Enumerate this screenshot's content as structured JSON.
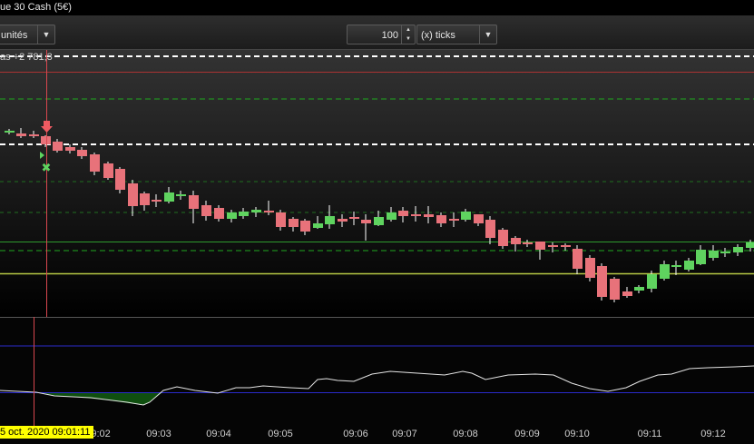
{
  "window": {
    "title": "ue 30 Cash (5€)"
  },
  "toolbar": {
    "units_label": "unités",
    "quantity_value": "100",
    "ticks_label": "(x) ticks"
  },
  "chart": {
    "pnl_label": "as +2 781,3",
    "time_labels": [
      "09:02",
      "09:03",
      "09:04",
      "09:05",
      "09:06",
      "09:07",
      "09:08",
      "09:09",
      "09:10",
      "09:11",
      "09:12"
    ],
    "cursor_time": "5 oct. 2020 09:01:11",
    "colors": {
      "bull": "#5fd35f",
      "bear": "#e8727a",
      "background": "#000000"
    }
  }
}
